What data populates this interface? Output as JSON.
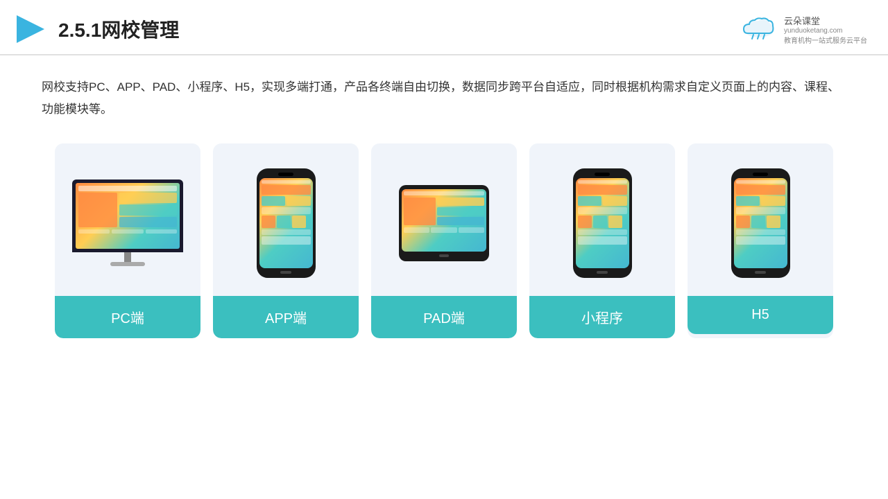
{
  "header": {
    "title": "2.5.1网校管理",
    "logo_brand": "云朵课堂",
    "logo_url": "yunduoketang.com",
    "logo_tagline": "教育机构一站式服务云平台"
  },
  "description": "网校支持PC、APP、PAD、小程序、H5，实现多端打通，产品各终端自由切换，数据同步跨平台自适应，同时根据机构需求自定义页面上的内容、课程、功能模块等。",
  "cards": [
    {
      "id": "pc",
      "label": "PC端",
      "type": "monitor"
    },
    {
      "id": "app",
      "label": "APP端",
      "type": "phone"
    },
    {
      "id": "pad",
      "label": "PAD端",
      "type": "tablet"
    },
    {
      "id": "miniapp",
      "label": "小程序",
      "type": "phone"
    },
    {
      "id": "h5",
      "label": "H5",
      "type": "phone"
    }
  ]
}
